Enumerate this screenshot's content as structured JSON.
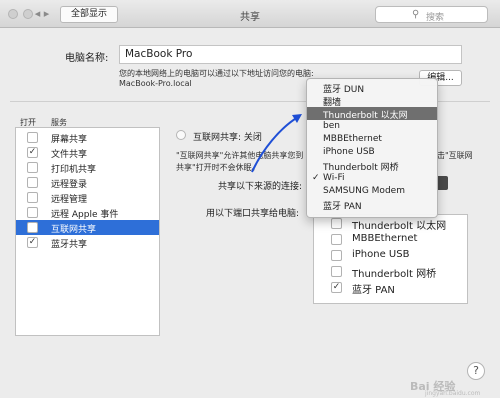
{
  "window": {
    "title": "共享",
    "show_all": "全部显示",
    "search_placeholder": "搜索"
  },
  "computer_name": {
    "label": "电脑名称:",
    "value": "MacBook Pro",
    "description": "您的本地网络上的电脑可以通过以下地址访问您的电脑:",
    "host": "MacBook-Pro.local",
    "edit_button": "编辑..."
  },
  "services": {
    "header_on": "打开",
    "header_name": "服务",
    "items": [
      {
        "name": "屏幕共享",
        "checked": false,
        "selected": false
      },
      {
        "name": "文件共享",
        "checked": true,
        "selected": false
      },
      {
        "name": "打印机共享",
        "checked": false,
        "selected": false
      },
      {
        "name": "远程登录",
        "checked": false,
        "selected": false
      },
      {
        "name": "远程管理",
        "checked": false,
        "selected": false
      },
      {
        "name": "远程 Apple 事件",
        "checked": false,
        "selected": false
      },
      {
        "name": "互联网共享",
        "checked": false,
        "selected": true
      },
      {
        "name": "蓝牙共享",
        "checked": true,
        "selected": false
      }
    ]
  },
  "detail": {
    "status": "互联网共享: 关闭",
    "desc_line1": "\"互联网共享\"允许其他电脑共享您到",
    "desc_line1_right": "击\"互联网",
    "desc_line2": "共享\"打开时不会休眠。",
    "desc_line2_right": "",
    "share_from_label": "共享以下来源的连接:",
    "share_to_label": "用以下端口共享给电脑:"
  },
  "dropdown": {
    "items": [
      {
        "label": "蓝牙 DUN",
        "checked": false,
        "highlighted": false
      },
      {
        "label": "翻墙",
        "checked": false,
        "highlighted": false
      },
      {
        "label": "Thunderbolt 以太网",
        "checked": false,
        "highlighted": true
      },
      {
        "label": "ben",
        "checked": false,
        "highlighted": false
      },
      {
        "label": "MBBEthernet",
        "checked": false,
        "highlighted": false
      },
      {
        "label": "iPhone USB",
        "checked": false,
        "highlighted": false
      },
      {
        "label": "Thunderbolt 网桥",
        "checked": false,
        "highlighted": false
      },
      {
        "label": "Wi-Fi",
        "checked": true,
        "highlighted": false
      },
      {
        "label": "SAMSUNG Modem",
        "checked": false,
        "highlighted": false
      },
      {
        "label": "蓝牙 PAN",
        "checked": false,
        "highlighted": false
      }
    ],
    "check_mark": "✓"
  },
  "ports": {
    "items": [
      {
        "name": "Thunderbolt 以太网",
        "checked": false
      },
      {
        "name": "MBBEthernet",
        "checked": false
      },
      {
        "name": "iPhone USB",
        "checked": false
      },
      {
        "name": "Thunderbolt 网桥",
        "checked": false
      },
      {
        "name": "蓝牙 PAN",
        "checked": true
      }
    ]
  },
  "help": "?",
  "watermark": "Bai 经验",
  "watermark_url": "jingyan.baidu.com",
  "colors": {
    "selection": "#2e6fd8",
    "menu_highlight": "#6f6f6f",
    "arrow": "#1f4fd6"
  }
}
